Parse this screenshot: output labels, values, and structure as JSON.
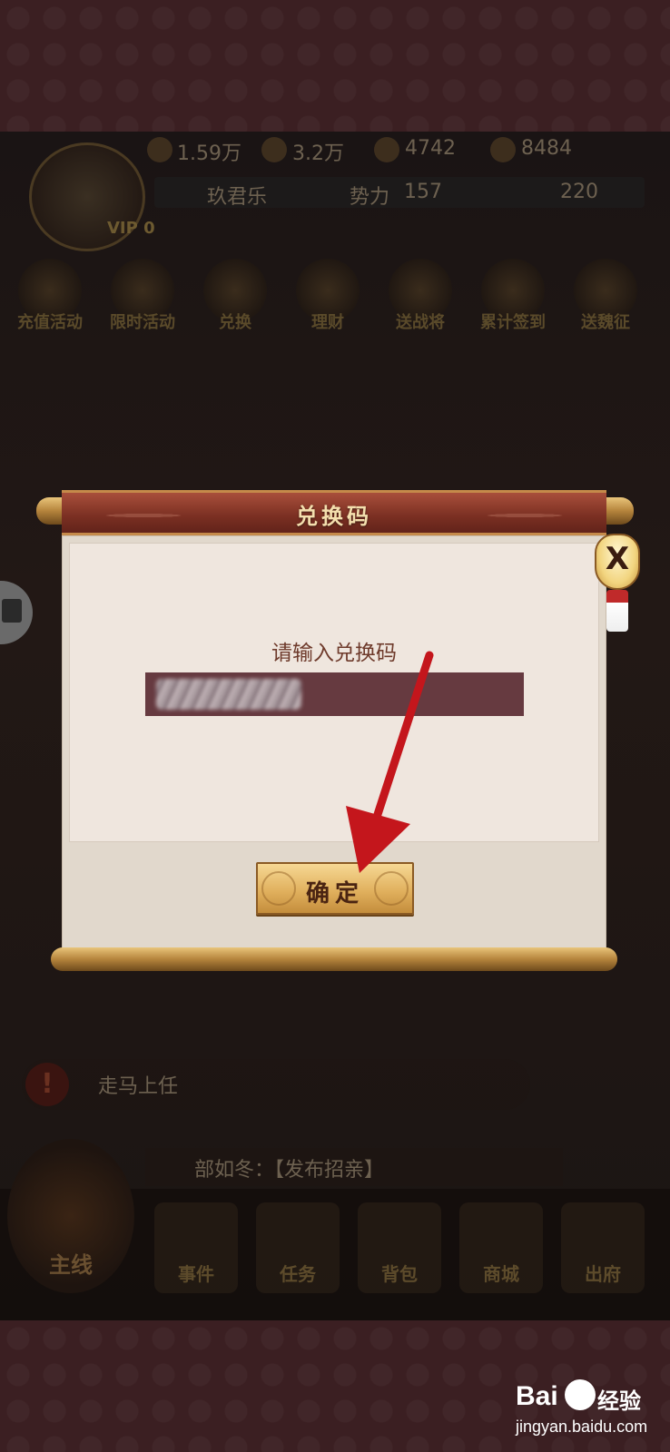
{
  "game_background": {
    "resources": [
      "1.59万",
      "3.2万",
      "4742",
      "8484"
    ],
    "player_name": "玖君乐",
    "power_label": "势力",
    "power_value": "157",
    "ingot_value": "220",
    "vip": "VIP 0",
    "activities": [
      "充值活动",
      "限时活动",
      "兑换",
      "理财",
      "送战将",
      "累计签到",
      "送魏征"
    ],
    "task_text": "走马上任",
    "news_text": "部如冬：【发布招亲】",
    "mainline_label": "主线",
    "nav": [
      "事件",
      "任务",
      "背包",
      "商城",
      "出府"
    ]
  },
  "dialog": {
    "title": "兑换码",
    "prompt": "请输入兑换码",
    "code_input_value": "",
    "confirm_label": "确定",
    "close_label": "X"
  },
  "watermark": {
    "brand": "Bai",
    "brand_cn": "经验",
    "url": "jingyan.baidu.com"
  },
  "colors": {
    "arrow": "#c4161c",
    "input_bg": "#663a40",
    "header_bg": "#7a2f22"
  }
}
